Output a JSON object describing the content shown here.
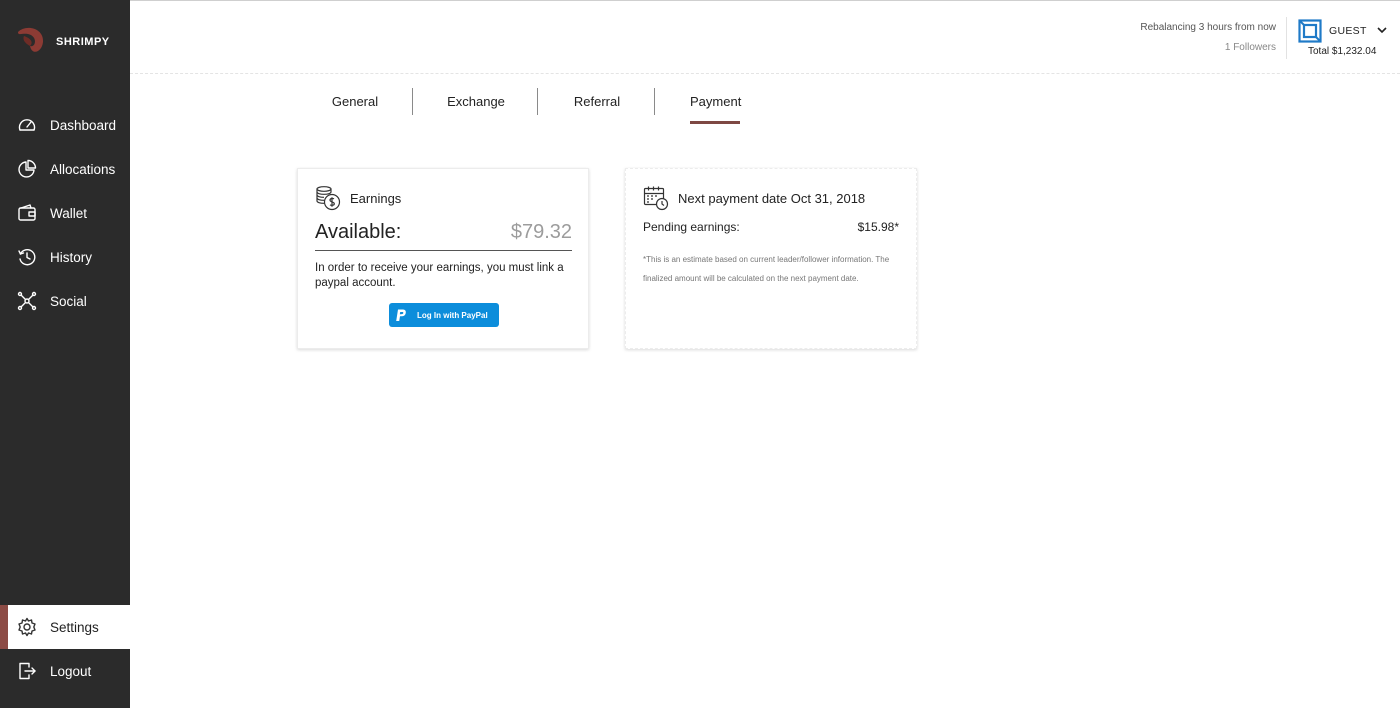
{
  "app": {
    "name": "SHRIMPY"
  },
  "sidebar": {
    "items": [
      {
        "label": "Dashboard",
        "icon": "dashboard-gauge-icon"
      },
      {
        "label": "Allocations",
        "icon": "pie-chart-icon"
      },
      {
        "label": "Wallet",
        "icon": "wallet-icon"
      },
      {
        "label": "History",
        "icon": "history-clock-icon"
      },
      {
        "label": "Social",
        "icon": "network-icon"
      }
    ],
    "bottom_items": [
      {
        "label": "Settings",
        "icon": "gear-icon",
        "active": true
      },
      {
        "label": "Logout",
        "icon": "logout-icon"
      }
    ]
  },
  "header": {
    "rebalancing": "Rebalancing 3 hours from now",
    "followers": "1 Followers",
    "account_label": "GUEST",
    "total": "Total $1,232.04"
  },
  "tabs": [
    {
      "label": "General"
    },
    {
      "label": "Exchange"
    },
    {
      "label": "Referral"
    },
    {
      "label": "Payment",
      "active": true
    }
  ],
  "earnings_card": {
    "title": "Earnings",
    "available_label": "Available:",
    "available_value": "$79.32",
    "message": "In order to receive your earnings, you must link a paypal account.",
    "paypal_button": "Log In with PayPal"
  },
  "payment_card": {
    "title": "Next payment date Oct 31, 2018",
    "pending_label": "Pending earnings:",
    "pending_value": "$15.98*",
    "disclaimer": "*This is an estimate based on current leader/follower information. The finalized amount will be calculated on the next payment date."
  },
  "colors": {
    "sidebar_bg": "#2b2b2b",
    "accent": "#7e4843",
    "paypal_blue": "#0c8ddb",
    "account_blue": "#1f7ac7"
  }
}
